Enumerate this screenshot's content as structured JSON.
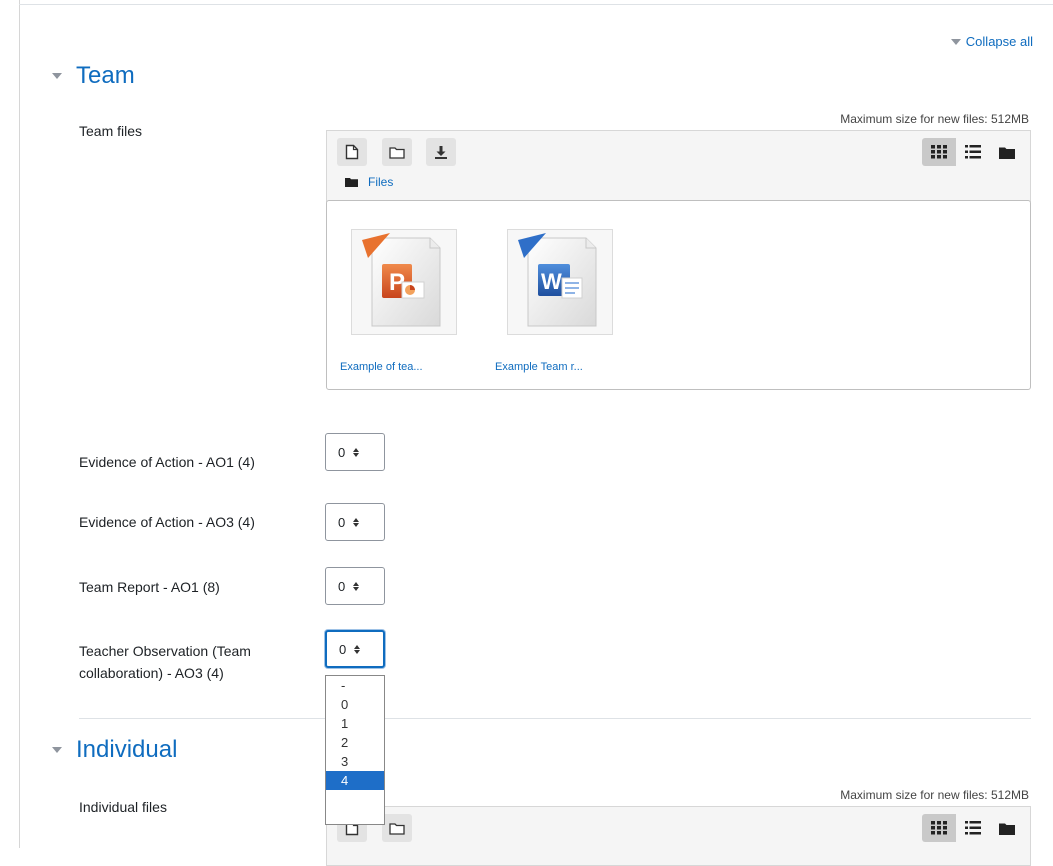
{
  "collapse_all": "Collapse all",
  "team": {
    "title": "Team",
    "files_label": "Team files",
    "max_size": "Maximum size for new files: 512MB",
    "path_label": "Files",
    "files": [
      {
        "name": "Example of tea...",
        "icon": "powerpoint-file-icon"
      },
      {
        "name": "Example Team r...",
        "icon": "word-file-icon"
      }
    ]
  },
  "grades": [
    {
      "label": "Evidence of Action - AO1 (4)",
      "value": "0"
    },
    {
      "label": "Evidence of Action - AO3 (4)",
      "value": "0"
    },
    {
      "label": "Team Report - AO1 (8)",
      "value": "0"
    },
    {
      "label_line1": "Teacher Observation (Team",
      "label_line2": "collaboration) - AO3 (4)",
      "value": "0"
    }
  ],
  "dropdown_options": [
    "-",
    "0",
    "1",
    "2",
    "3",
    "4"
  ],
  "dropdown_selected": "4",
  "individual": {
    "title": "Individual",
    "files_label": "Individual files",
    "max_size": "Maximum size for new files: 512MB"
  },
  "icons": {
    "add_file": "add-file-icon",
    "create_folder": "create-folder-icon",
    "download": "download-icon",
    "view_icons": "grid-view-icon",
    "view_list": "list-view-icon",
    "view_tree": "folder-tree-view-icon"
  },
  "colors": {
    "link": "#0f6cbf",
    "selected_option": "#1e6ec8",
    "toolbar_bg": "#f5f5f5"
  }
}
